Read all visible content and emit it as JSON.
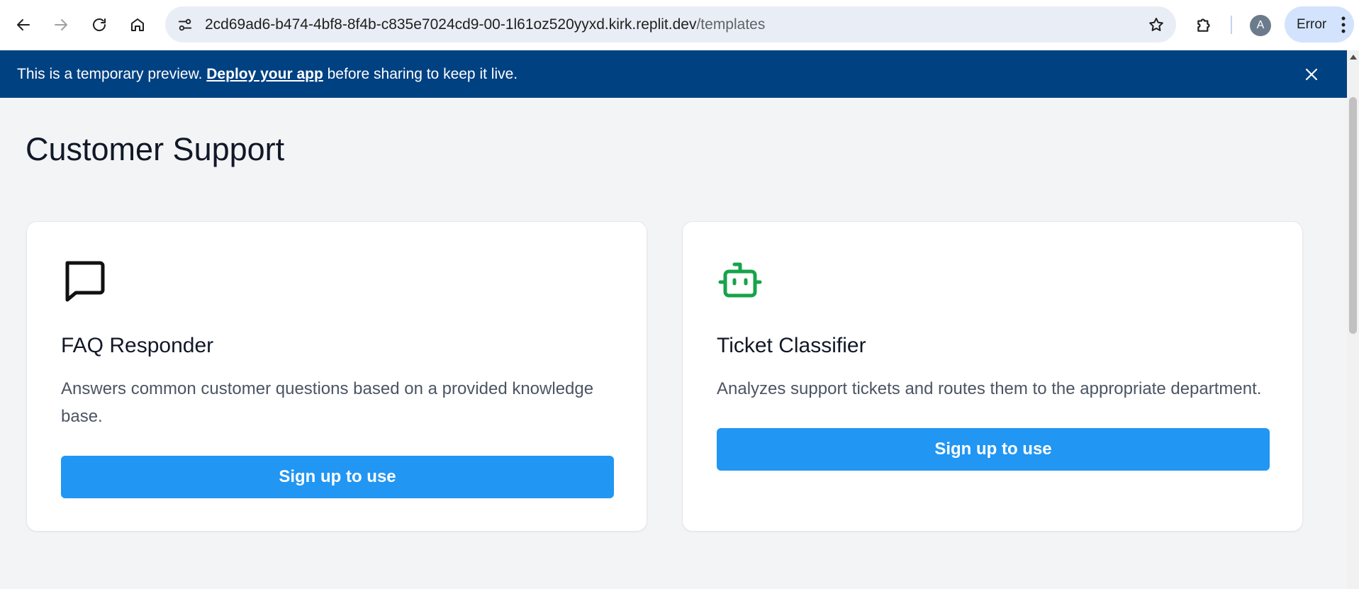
{
  "browser": {
    "url_host": "2cd69ad6-b474-4bf8-8f4b-c835e7024cd9-00-1l61oz520yyxd.kirk.replit.dev",
    "url_path": "/templates",
    "avatar_letter": "A",
    "error_chip": "Error"
  },
  "banner": {
    "text_before": "This is a temporary preview. ",
    "link": "Deploy your app",
    "text_after": " before sharing to keep it live."
  },
  "page": {
    "title": "Customer Support"
  },
  "cards": [
    {
      "icon": "message-square-icon",
      "title": "FAQ Responder",
      "description": "Answers common customer questions based on a provided knowledge base.",
      "button": "Sign up to use"
    },
    {
      "icon": "bot-icon",
      "title": "Ticket Classifier",
      "description": "Analyzes support tickets and routes them to the appropriate department.",
      "button": "Sign up to use"
    }
  ],
  "colors": {
    "banner": "#004182",
    "button": "#2196f3",
    "bot_icon": "#16a34a"
  }
}
